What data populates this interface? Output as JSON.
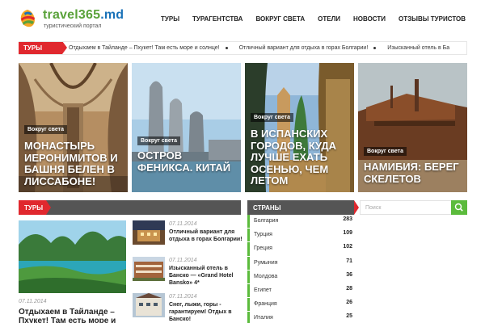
{
  "header": {
    "logo_title": "travel365",
    "logo_tld": ".md",
    "logo_subtitle": "туристический портал",
    "nav": [
      "ТУРЫ",
      "ТУРАГЕНТСТВА",
      "ВОКРУГ СВЕТА",
      "ОТЕЛИ",
      "НОВОСТИ",
      "ОТЗЫВЫ ТУРИСТОВ"
    ]
  },
  "ticker": {
    "label": "ТУРЫ",
    "items": [
      "Отдыхаем в Тайланде – Пхукет! Там есть море и солнце!",
      "Отличный вариант для отдыха в горах Болгарии!",
      "Изысканный отель в Ба"
    ]
  },
  "features": [
    {
      "badge": "Вокруг света",
      "title": "Монастырь Иеронимитов и башня Белен в Лиссабоне!"
    },
    {
      "badge": "Вокруг света",
      "title": "Остров Феникса. Китай"
    },
    {
      "badge": "Вокруг света",
      "title": "В испанских городов, куда лучше ехать осенью, чем летом"
    },
    {
      "badge": "Вокруг света",
      "title": "Намибия: берег скелетов"
    }
  ],
  "tours": {
    "label": "ТУРЫ",
    "main": {
      "date": "07.11.2014",
      "title": "Отдыхаем в Тайланде – Пхукет! Там есть море и"
    },
    "side": [
      {
        "date": "07.11.2014",
        "title": "Отличный вариант для отдыха в горах Болгарии!"
      },
      {
        "date": "07.11.2014",
        "title": "Изысканный отель в Банско — «Grand Hotel Bansko» 4*"
      },
      {
        "date": "07.11.2014",
        "title": "Снег, лыжи, горы - гарантируем! Отдых в Банско!"
      }
    ]
  },
  "countries": {
    "label": "СТРАНЫ",
    "rows": [
      {
        "name": "Болгария",
        "count": "283"
      },
      {
        "name": "Турция",
        "count": "109"
      },
      {
        "name": "Греция",
        "count": "102"
      },
      {
        "name": "Румыния",
        "count": "71"
      },
      {
        "name": "Молдова",
        "count": "36"
      },
      {
        "name": "Египет",
        "count": "28"
      },
      {
        "name": "Франция",
        "count": "26"
      },
      {
        "name": "Италия",
        "count": "25"
      }
    ]
  },
  "search": {
    "placeholder": "Поиск"
  },
  "colors": {
    "accent_red": "#e0282e",
    "accent_green": "#5bbb3c",
    "logo_green": "#5aa23a",
    "logo_blue": "#1a72b8"
  }
}
